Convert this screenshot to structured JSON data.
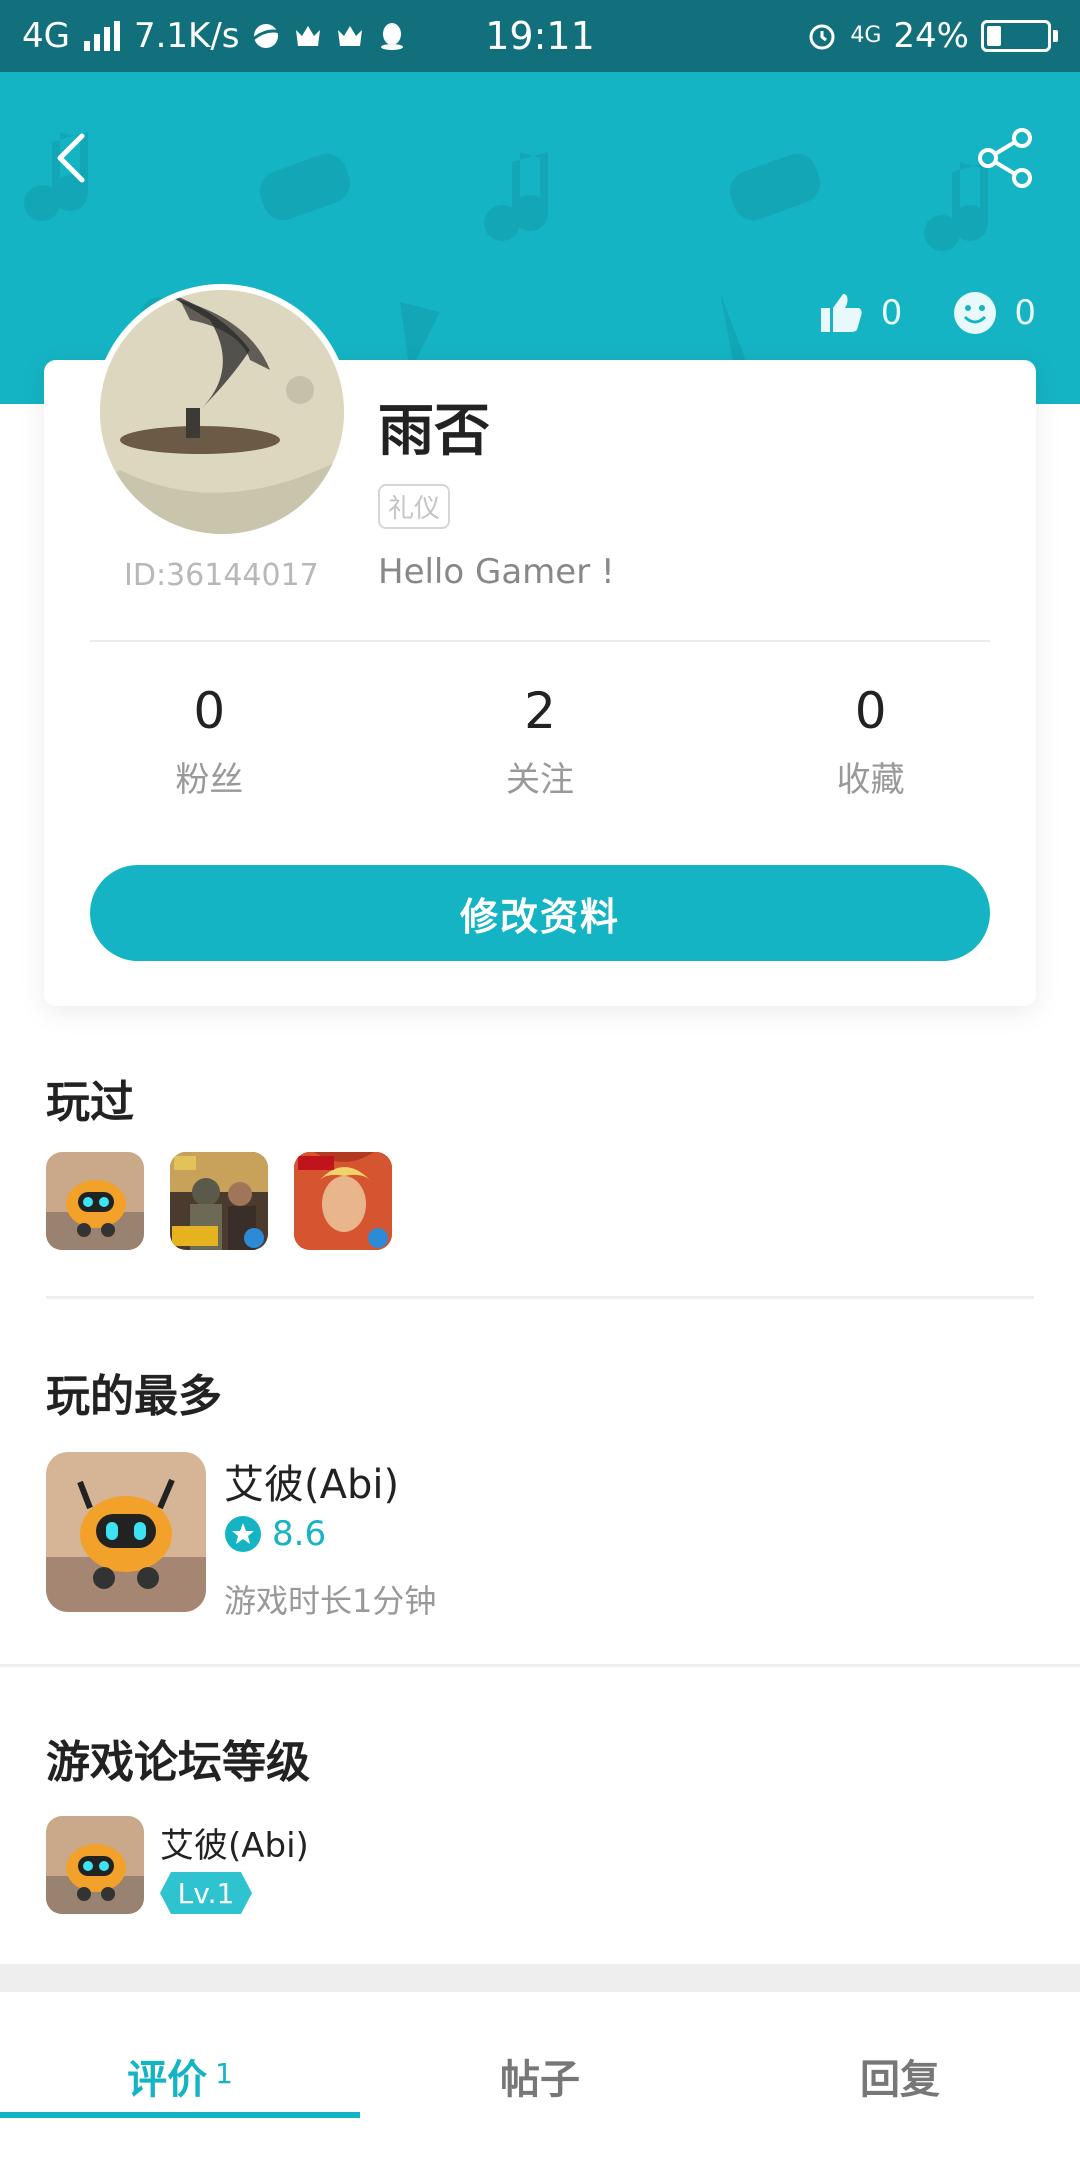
{
  "status_bar": {
    "network": "4G",
    "speed": "7.1K/s",
    "time": "19:11",
    "net2": "4G",
    "battery": "24%",
    "battery_level": 0.24
  },
  "header": {
    "likes": "0",
    "smiles": "0",
    "accent_color": "#15b4c4"
  },
  "profile": {
    "name": "雨否",
    "tag": "礼仪",
    "id": "ID:36144017",
    "bio": "Hello Gamer !",
    "stats": [
      {
        "value": "0",
        "label": "粉丝"
      },
      {
        "value": "2",
        "label": "关注"
      },
      {
        "value": "0",
        "label": "收藏"
      }
    ],
    "edit_label": "修改资料"
  },
  "played": {
    "title": "玩过",
    "games": [
      "abi-icon",
      "pubg-icon",
      "honor-of-kings-icon"
    ]
  },
  "most_played": {
    "title": "玩的最多",
    "name": "艾彼(Abi)",
    "rating": "8.6",
    "playtime": "游戏时长1分钟"
  },
  "forum": {
    "title": "游戏论坛等级",
    "name": "艾彼(Abi)",
    "level": "Lv.1"
  },
  "tabs": [
    {
      "label": "评价",
      "count": "1"
    },
    {
      "label": "帖子"
    },
    {
      "label": "回复"
    }
  ]
}
